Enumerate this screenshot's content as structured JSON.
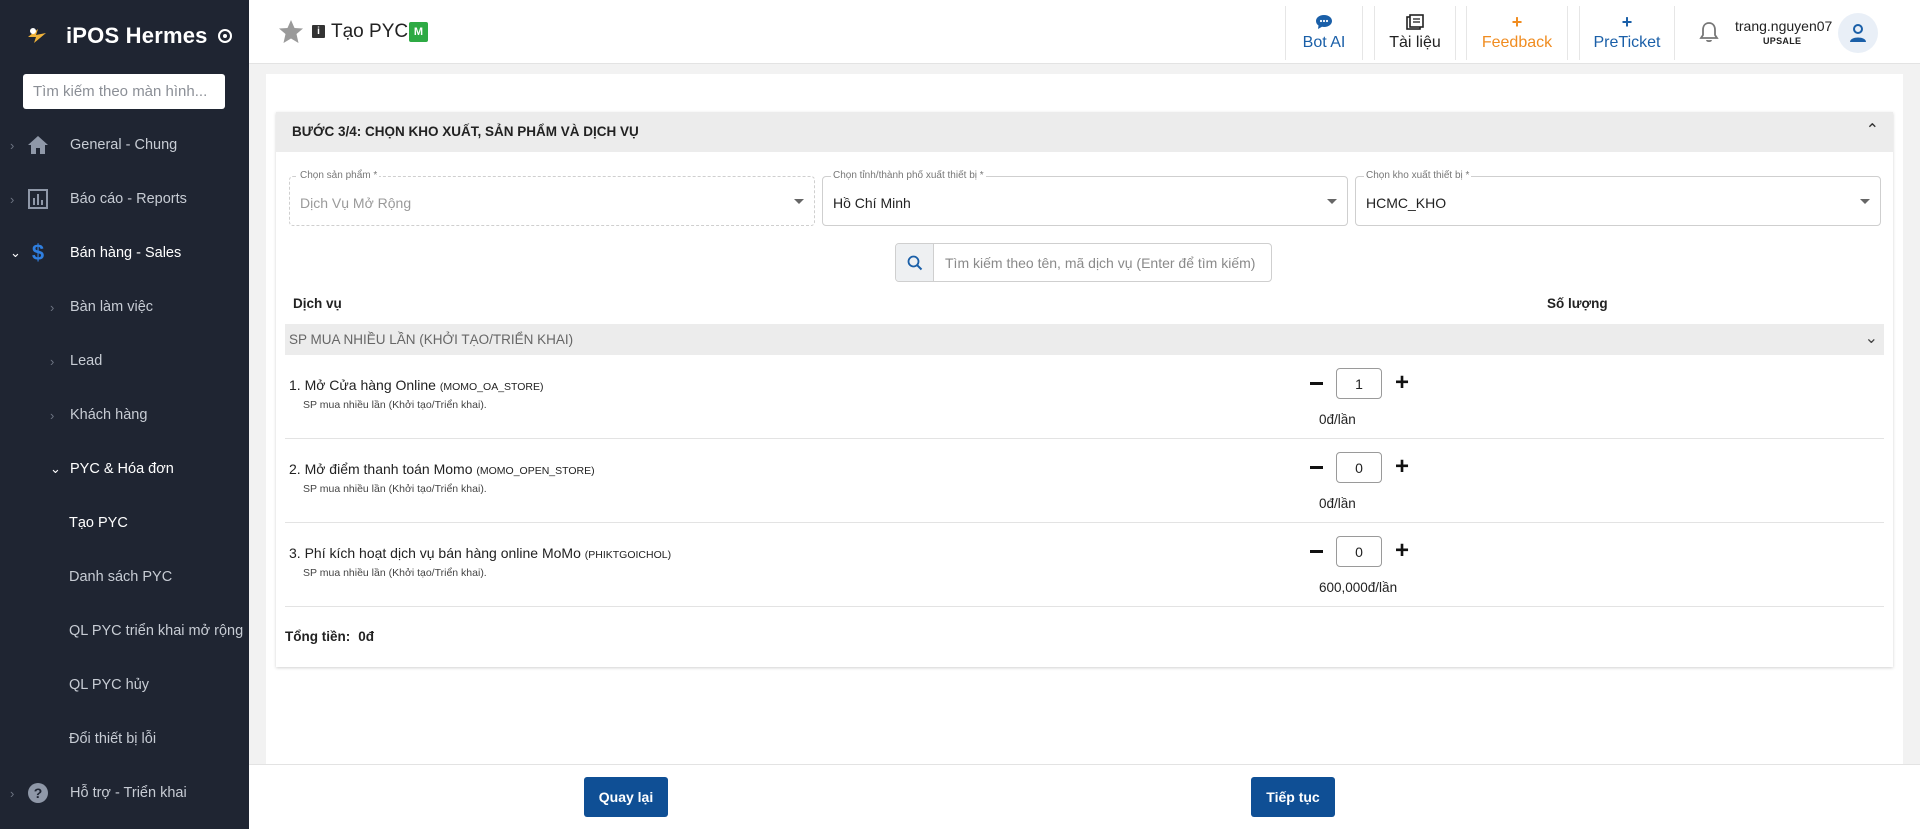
{
  "app": {
    "brand": "iPOS Hermes",
    "search_placeholder": "Tìm kiếm theo màn hình..."
  },
  "sidebar": {
    "items": [
      {
        "label": "General - Chung",
        "icon": "home-icon"
      },
      {
        "label": "Báo cáo - Reports",
        "icon": "bar-chart-icon"
      },
      {
        "label": "Bán hàng - Sales",
        "icon": "dollar-icon",
        "expanded": true
      },
      {
        "label": "Bàn làm việc"
      },
      {
        "label": "Lead"
      },
      {
        "label": "Khách hàng"
      },
      {
        "label": "PYC & Hóa đơn",
        "expanded": true
      },
      {
        "label": "Tạo PYC",
        "active": true
      },
      {
        "label": "Danh sách PYC"
      },
      {
        "label": "QL PYC triển khai mở rộng"
      },
      {
        "label": "QL PYC hủy"
      },
      {
        "label": "Đổi thiết bị lỗi"
      },
      {
        "label": "Hỗ trợ - Triển khai",
        "icon": "help-circle-icon"
      }
    ]
  },
  "header": {
    "title": "Tạo PYC",
    "badge": "M",
    "info_icon": "i",
    "buttons": {
      "bot_ai": "Bot AI",
      "docs": "Tài liệu",
      "feedback": "Feedback",
      "preticket": "PreTicket"
    },
    "feedback_icon": "+",
    "preticket_icon": "+",
    "user": {
      "name": "trang.nguyen07",
      "role": "UPSALE"
    }
  },
  "step": {
    "title": "BƯỚC 3/4: CHỌN KHO XUẤT, SẢN PHẨM VÀ DỊCH VỤ",
    "fields": {
      "product": {
        "label": "Chọn sản phẩm *",
        "value": "Dịch Vụ Mở Rộng",
        "disabled": true
      },
      "province": {
        "label": "Chọn tỉnh/thành phố xuất thiết bị *",
        "value": "Hồ Chí Minh"
      },
      "warehouse": {
        "label": "Chọn kho xuất thiết bị *",
        "value": "HCMC_KHO"
      }
    },
    "service_search_placeholder": "Tìm kiếm theo tên, mã dịch vụ (Enter để tìm kiếm)",
    "columns": {
      "service": "Dịch vụ",
      "quantity": "Số lượng"
    },
    "group": {
      "label": "SP MUA NHIỀU LẦN (KHỞI TẠO/TRIỂN KHAI)",
      "rows": [
        {
          "name": "1. Mở Cửa hàng Online",
          "code": "(MOMO_OA_STORE)",
          "sub": "SP mua nhiều lần (Khởi tạo/Triển khai).",
          "qty": "1",
          "price": "0đ/lần"
        },
        {
          "name": "2. Mở điểm thanh toán Momo",
          "code": "(MOMO_OPEN_STORE)",
          "sub": "SP mua nhiều lần (Khởi tạo/Triển khai).",
          "qty": "0",
          "price": "0đ/lần"
        },
        {
          "name": "3. Phí kích hoạt dịch vụ bán hàng online MoMo",
          "code": "(PHIKTGOICHOL)",
          "sub": "SP mua nhiều lần (Khởi tạo/Triển khai).",
          "qty": "0",
          "price": "600,000đ/lần"
        }
      ]
    },
    "total": {
      "label": "Tổng tiền:",
      "value": "0đ"
    }
  },
  "footer": {
    "back": "Quay lại",
    "next": "Tiếp tục"
  },
  "colors": {
    "sidebar_bg": "#1f2532",
    "primary_button": "#0f4f95",
    "link_blue": "#1a5fa8",
    "feedback_orange": "#f08c20",
    "badge_green": "#2eaa44"
  }
}
